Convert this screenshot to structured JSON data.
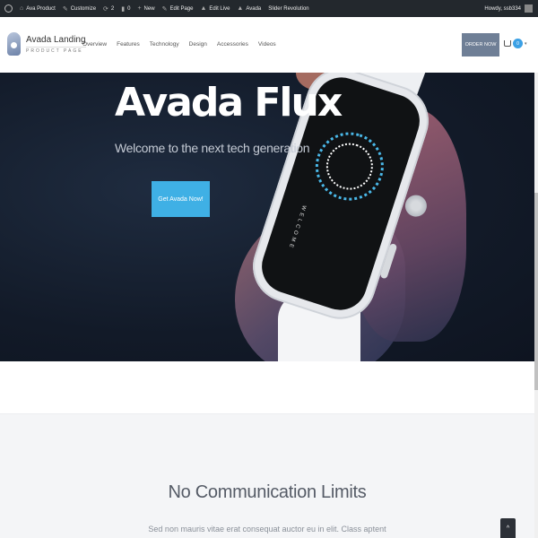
{
  "admin_bar": {
    "site_name": "Ava Product",
    "customize": "Customize",
    "updates_count": "2",
    "comments_count": "0",
    "new_label": "New",
    "edit_page": "Edit Page",
    "edit_live": "Edit Live",
    "avada": "Avada",
    "slider_revolution": "Slider Revolution",
    "howdy": "Howdy, ssb334"
  },
  "header": {
    "logo_title": "Avada Landing",
    "logo_subtitle": "PRODUCT PAGE",
    "nav": [
      "Overview",
      "Features",
      "Technology",
      "Design",
      "Accessories",
      "Videos"
    ],
    "order_button": "ORDER NOW",
    "cart_count": "0"
  },
  "hero": {
    "title": "Avada Flux",
    "subtitle": "Welcome to the next tech generation",
    "cta": "Get Avada Now!",
    "watch_screen_text": "WELCOME"
  },
  "section": {
    "title": "No Communication Limits",
    "text": "Sed non mauris vitae erat consequat auctor eu in elit. Class aptent"
  },
  "colors": {
    "admin_bar": "#23282d",
    "accent": "#3fb0e5",
    "order_button": "#6f7f96"
  }
}
